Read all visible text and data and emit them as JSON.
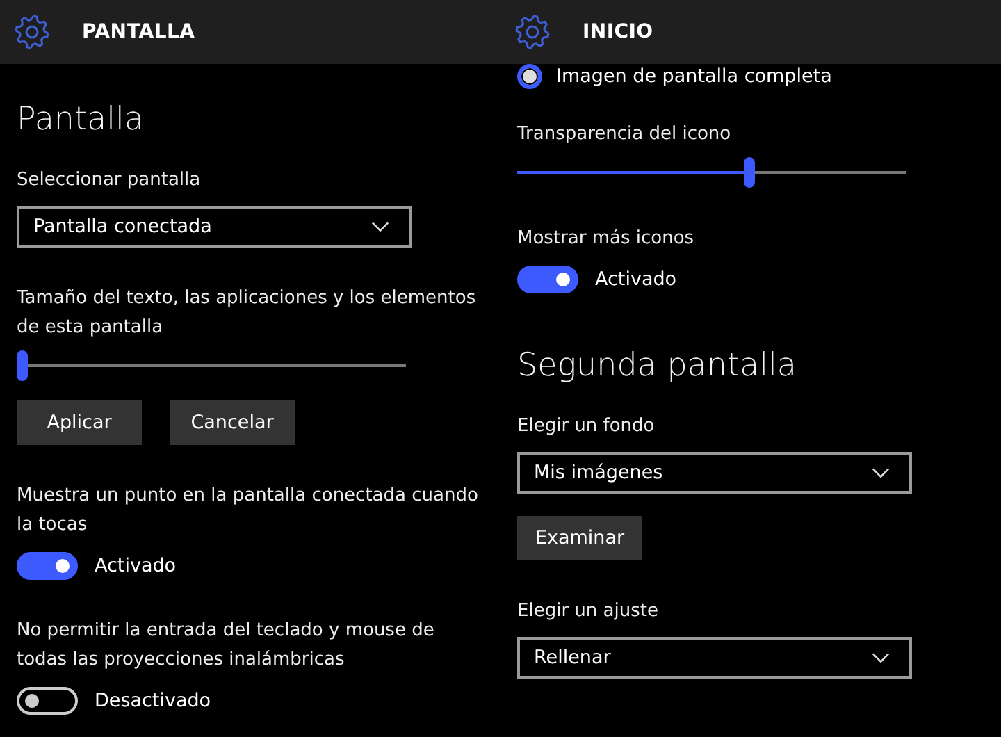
{
  "panels": [
    {
      "title": "PANTALLA",
      "items": [
        {
          "kind": "heading",
          "text": "Pantalla"
        },
        {
          "kind": "label",
          "text": "Seleccionar pantalla"
        },
        {
          "kind": "dropdown",
          "value": "Pantalla conectada"
        },
        {
          "kind": "label",
          "text": "Tamaño del texto, las aplicaciones y los elementos de esta pantalla"
        },
        {
          "kind": "slider",
          "level": 0
        },
        {
          "kind": "buttons",
          "buttons": [
            "Aplicar",
            "Cancelar"
          ]
        },
        {
          "kind": "label",
          "text": "Muestra un punto en la pantalla conectada cuando la tocas"
        },
        {
          "kind": "toggle",
          "on": true,
          "state_text": "Activado"
        },
        {
          "kind": "label",
          "text": "No permitir la entrada del teclado y mouse de todas las proyecciones inalámbricas"
        },
        {
          "kind": "toggle",
          "on": false,
          "state_text": "Desactivado"
        }
      ]
    },
    {
      "title": "INICIO",
      "items": [
        {
          "kind": "radio",
          "selected": true,
          "text": "Imagen de pantalla completa"
        },
        {
          "kind": "label",
          "text": "Transparencia del icono"
        },
        {
          "kind": "slider",
          "level": 0.6
        },
        {
          "kind": "label",
          "text": "Mostrar más iconos"
        },
        {
          "kind": "toggle",
          "on": true,
          "state_text": "Activado"
        },
        {
          "kind": "heading",
          "text": "Segunda pantalla"
        },
        {
          "kind": "label",
          "text": "Elegir un fondo"
        },
        {
          "kind": "dropdown",
          "value": "Mis imágenes"
        },
        {
          "kind": "buttons",
          "buttons": [
            "Examinar"
          ]
        },
        {
          "kind": "label",
          "text": "Elegir un ajuste"
        },
        {
          "kind": "dropdown",
          "value": "Rellenar"
        }
      ]
    }
  ]
}
